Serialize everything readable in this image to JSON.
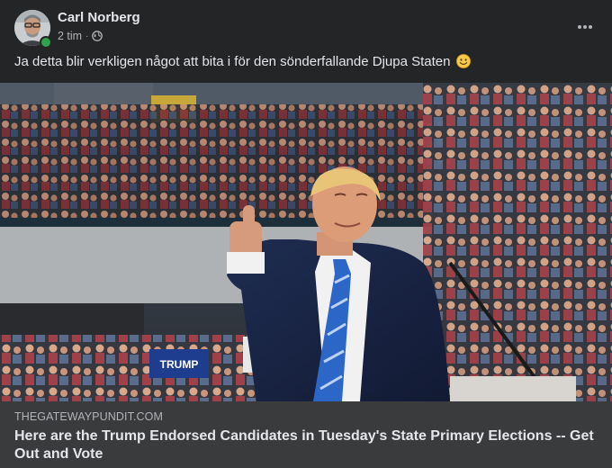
{
  "post": {
    "author": "Carl Norberg",
    "time": "2 tim",
    "separator": "·",
    "privacy_icon": "globe-icon",
    "text": "Ja detta blir verkligen något att bita i för den sönderfallande Djupa Staten",
    "emoji": "smiling-face-emoji",
    "more_icon": "more-options-icon"
  },
  "photo": {
    "sign_text": "TRUMP"
  },
  "link_preview": {
    "domain": "THEGATEWAYPUNDIT.COM",
    "title": "Here are the Trump Endorsed Candidates in Tuesday's State Primary Elections -- Get Out and Vote"
  },
  "colors": {
    "card_bg": "#242526",
    "link_bar_bg": "#3a3b3c",
    "online": "#31a24c",
    "text_primary": "#e4e6eb",
    "text_secondary": "#b0b3b8"
  }
}
